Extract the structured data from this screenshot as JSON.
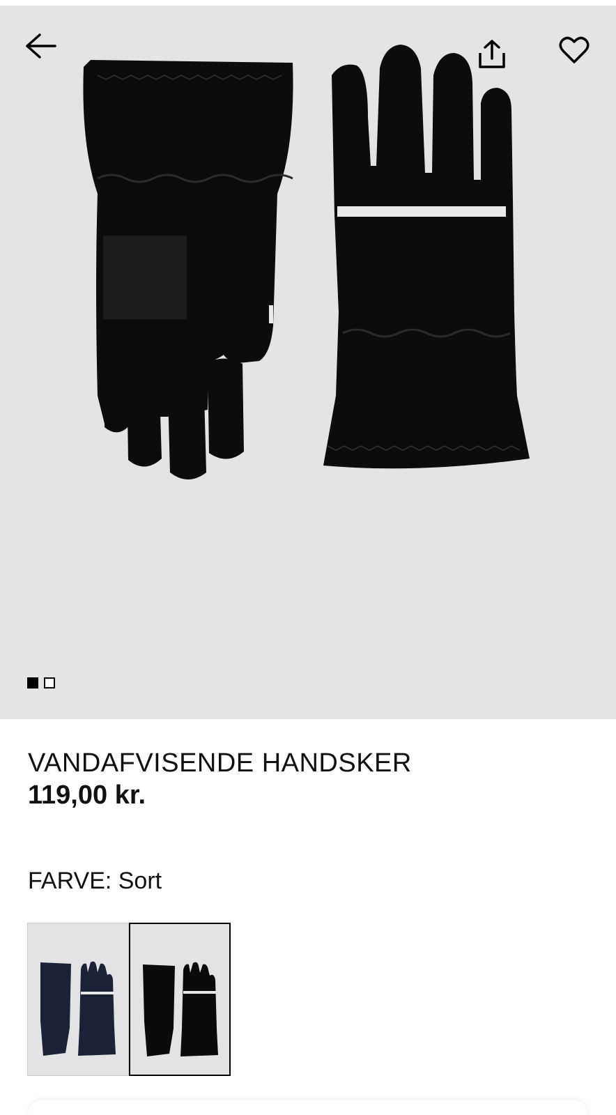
{
  "product": {
    "title": "VANDAFVISENDE HANDSKER",
    "price": "119,00 kr.",
    "color_label": "FARVE: Sort"
  },
  "gallery": {
    "image_count": 2,
    "active_index": 1
  },
  "swatches": [
    {
      "name": "navy-gloves",
      "color": "#1c2236",
      "selected": false
    },
    {
      "name": "black-gloves",
      "color": "#0b0b0b",
      "selected": true
    }
  ],
  "icons": {
    "back": "arrow-left-icon",
    "share": "share-icon",
    "favorite": "heart-icon"
  },
  "colors": {
    "image_background": "#e4e3e5",
    "glove": "#0c0c0c",
    "reflective_stripe": "#e8e8e8"
  }
}
